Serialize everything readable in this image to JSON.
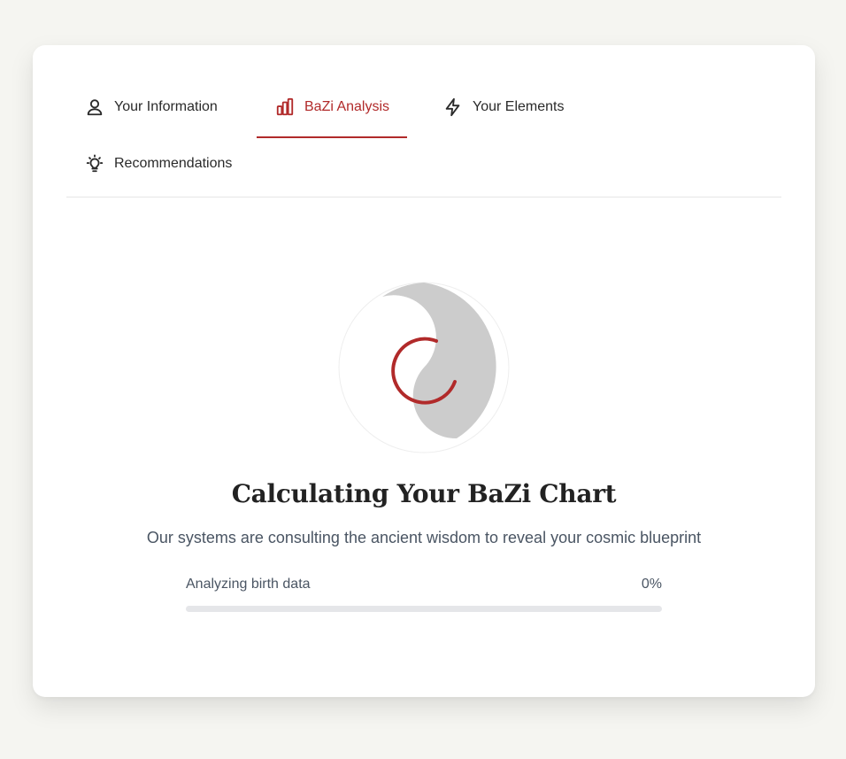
{
  "tabs": [
    {
      "label": "Your Information",
      "icon": "user-icon",
      "active": false
    },
    {
      "label": "BaZi Analysis",
      "icon": "bar-chart-icon",
      "active": true
    },
    {
      "label": "Your Elements",
      "icon": "lightning-icon",
      "active": false
    },
    {
      "label": "Recommendations",
      "icon": "lightbulb-icon",
      "active": false
    }
  ],
  "loading": {
    "title": "Calculating Your BaZi Chart",
    "subtitle": "Our systems are consulting the ancient wisdom to reveal your cosmic blueprint",
    "progress_label": "Analyzing birth data",
    "progress_value": 0,
    "progress_text": "0%"
  },
  "colors": {
    "accent": "#b12a2a",
    "background": "#f5f5f1",
    "card": "#ffffff",
    "yin": "#cccccc",
    "muted_text": "#4a5563"
  }
}
